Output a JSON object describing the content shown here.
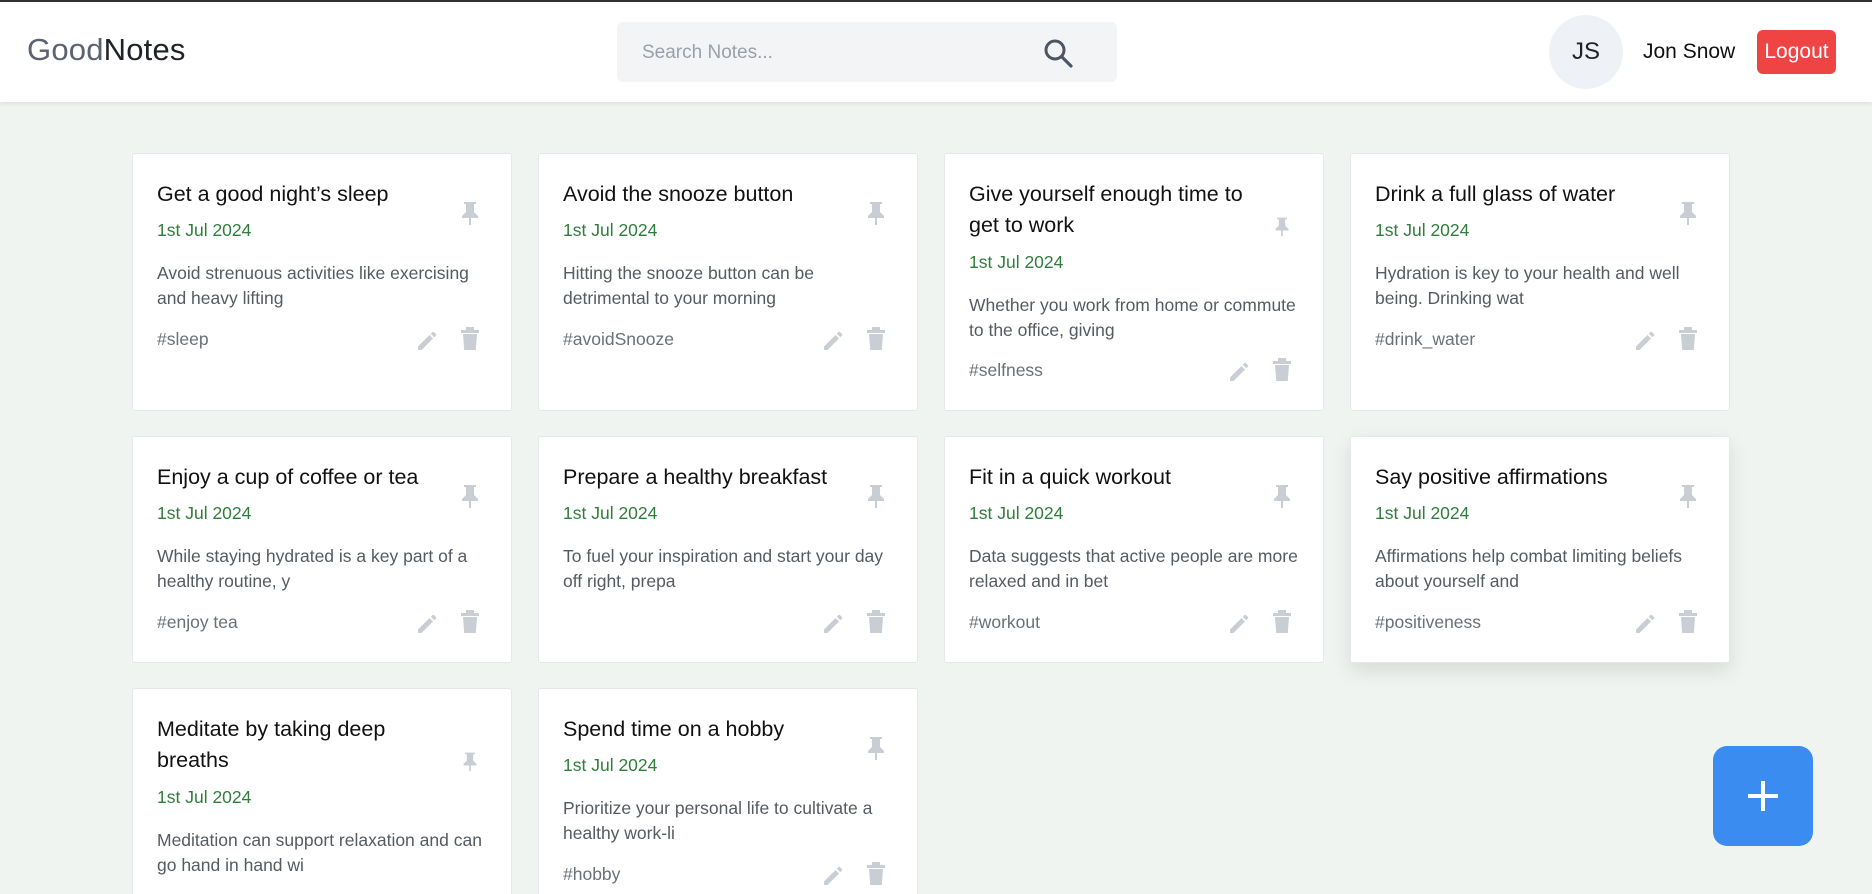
{
  "app": {
    "brand_part1": "Good",
    "brand_part2": "Notes"
  },
  "search": {
    "placeholder": "Search Notes..."
  },
  "user": {
    "initials": "JS",
    "name": "Jon Snow",
    "logout_label": "Logout"
  },
  "colors": {
    "date": "#2f7d3a",
    "logout": "#ef4444",
    "fab": "#3b8cf0"
  },
  "notes": [
    {
      "title": "Get a good night’s sleep",
      "date": "1st Jul 2024",
      "body": "Avoid strenuous activities like exercising and heavy lifting",
      "tag": "#sleep"
    },
    {
      "title": "Avoid the snooze button",
      "date": "1st Jul 2024",
      "body": "Hitting the snooze button can be detrimental to your morning",
      "tag": "#avoidSnooze"
    },
    {
      "title": "Give yourself enough time to get to work",
      "date": "1st Jul 2024",
      "body": "Whether you work from home or commute to the office, giving",
      "tag": "#selfness"
    },
    {
      "title": "Drink a full glass of water",
      "date": "1st Jul 2024",
      "body": "Hydration is key to your health and well being. Drinking wat",
      "tag": "#drink_water"
    },
    {
      "title": "Enjoy a cup of coffee or tea",
      "date": "1st Jul 2024",
      "body": "While staying hydrated is a key part of a healthy routine, y",
      "tag": "#enjoy tea"
    },
    {
      "title": "Prepare a healthy breakfast",
      "date": "1st Jul 2024",
      "body": "To fuel your inspiration and start your day off right, prepa",
      "tag": ""
    },
    {
      "title": "Fit in a quick workout",
      "date": "1st Jul 2024",
      "body": "Data suggests that active people are more relaxed and in bet",
      "tag": "#workout"
    },
    {
      "title": "Say positive affirmations",
      "date": "1st Jul 2024",
      "body": "Affirmations help combat limiting beliefs about yourself and",
      "tag": "#positiveness"
    },
    {
      "title": "Meditate by taking deep breaths",
      "date": "1st Jul 2024",
      "body": "Meditation can support relaxation and can go hand in hand wi",
      "tag": ""
    },
    {
      "title": "Spend time on a hobby",
      "date": "1st Jul 2024",
      "body": "Prioritize your personal life to cultivate a healthy work-li",
      "tag": "#hobby"
    }
  ],
  "icons": {
    "pin": "pin-icon",
    "edit": "pencil-icon",
    "delete": "trash-icon",
    "search": "search-icon",
    "add": "plus-icon"
  }
}
